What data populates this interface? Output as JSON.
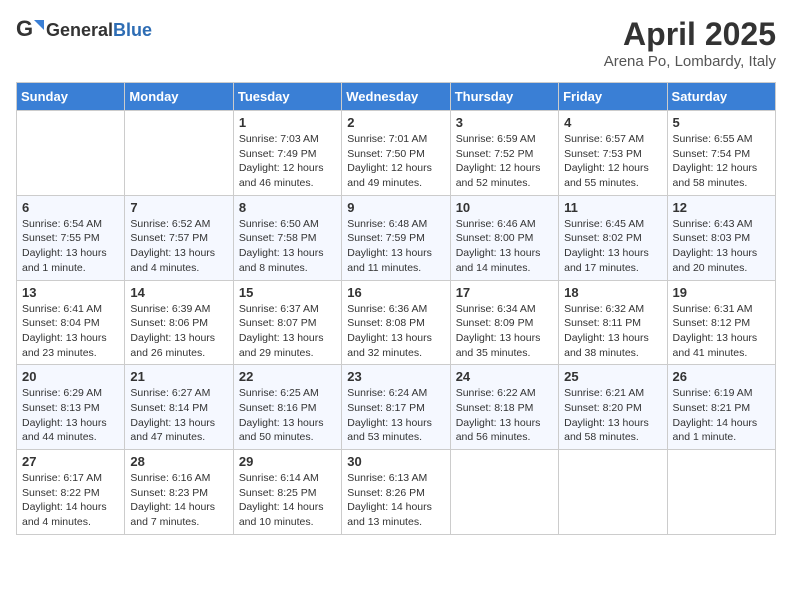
{
  "header": {
    "logo_general": "General",
    "logo_blue": "Blue",
    "month": "April 2025",
    "location": "Arena Po, Lombardy, Italy"
  },
  "weekdays": [
    "Sunday",
    "Monday",
    "Tuesday",
    "Wednesday",
    "Thursday",
    "Friday",
    "Saturday"
  ],
  "weeks": [
    [
      null,
      null,
      {
        "day": "1",
        "sunrise": "Sunrise: 7:03 AM",
        "sunset": "Sunset: 7:49 PM",
        "daylight": "Daylight: 12 hours and 46 minutes."
      },
      {
        "day": "2",
        "sunrise": "Sunrise: 7:01 AM",
        "sunset": "Sunset: 7:50 PM",
        "daylight": "Daylight: 12 hours and 49 minutes."
      },
      {
        "day": "3",
        "sunrise": "Sunrise: 6:59 AM",
        "sunset": "Sunset: 7:52 PM",
        "daylight": "Daylight: 12 hours and 52 minutes."
      },
      {
        "day": "4",
        "sunrise": "Sunrise: 6:57 AM",
        "sunset": "Sunset: 7:53 PM",
        "daylight": "Daylight: 12 hours and 55 minutes."
      },
      {
        "day": "5",
        "sunrise": "Sunrise: 6:55 AM",
        "sunset": "Sunset: 7:54 PM",
        "daylight": "Daylight: 12 hours and 58 minutes."
      }
    ],
    [
      {
        "day": "6",
        "sunrise": "Sunrise: 6:54 AM",
        "sunset": "Sunset: 7:55 PM",
        "daylight": "Daylight: 13 hours and 1 minute."
      },
      {
        "day": "7",
        "sunrise": "Sunrise: 6:52 AM",
        "sunset": "Sunset: 7:57 PM",
        "daylight": "Daylight: 13 hours and 4 minutes."
      },
      {
        "day": "8",
        "sunrise": "Sunrise: 6:50 AM",
        "sunset": "Sunset: 7:58 PM",
        "daylight": "Daylight: 13 hours and 8 minutes."
      },
      {
        "day": "9",
        "sunrise": "Sunrise: 6:48 AM",
        "sunset": "Sunset: 7:59 PM",
        "daylight": "Daylight: 13 hours and 11 minutes."
      },
      {
        "day": "10",
        "sunrise": "Sunrise: 6:46 AM",
        "sunset": "Sunset: 8:00 PM",
        "daylight": "Daylight: 13 hours and 14 minutes."
      },
      {
        "day": "11",
        "sunrise": "Sunrise: 6:45 AM",
        "sunset": "Sunset: 8:02 PM",
        "daylight": "Daylight: 13 hours and 17 minutes."
      },
      {
        "day": "12",
        "sunrise": "Sunrise: 6:43 AM",
        "sunset": "Sunset: 8:03 PM",
        "daylight": "Daylight: 13 hours and 20 minutes."
      }
    ],
    [
      {
        "day": "13",
        "sunrise": "Sunrise: 6:41 AM",
        "sunset": "Sunset: 8:04 PM",
        "daylight": "Daylight: 13 hours and 23 minutes."
      },
      {
        "day": "14",
        "sunrise": "Sunrise: 6:39 AM",
        "sunset": "Sunset: 8:06 PM",
        "daylight": "Daylight: 13 hours and 26 minutes."
      },
      {
        "day": "15",
        "sunrise": "Sunrise: 6:37 AM",
        "sunset": "Sunset: 8:07 PM",
        "daylight": "Daylight: 13 hours and 29 minutes."
      },
      {
        "day": "16",
        "sunrise": "Sunrise: 6:36 AM",
        "sunset": "Sunset: 8:08 PM",
        "daylight": "Daylight: 13 hours and 32 minutes."
      },
      {
        "day": "17",
        "sunrise": "Sunrise: 6:34 AM",
        "sunset": "Sunset: 8:09 PM",
        "daylight": "Daylight: 13 hours and 35 minutes."
      },
      {
        "day": "18",
        "sunrise": "Sunrise: 6:32 AM",
        "sunset": "Sunset: 8:11 PM",
        "daylight": "Daylight: 13 hours and 38 minutes."
      },
      {
        "day": "19",
        "sunrise": "Sunrise: 6:31 AM",
        "sunset": "Sunset: 8:12 PM",
        "daylight": "Daylight: 13 hours and 41 minutes."
      }
    ],
    [
      {
        "day": "20",
        "sunrise": "Sunrise: 6:29 AM",
        "sunset": "Sunset: 8:13 PM",
        "daylight": "Daylight: 13 hours and 44 minutes."
      },
      {
        "day": "21",
        "sunrise": "Sunrise: 6:27 AM",
        "sunset": "Sunset: 8:14 PM",
        "daylight": "Daylight: 13 hours and 47 minutes."
      },
      {
        "day": "22",
        "sunrise": "Sunrise: 6:25 AM",
        "sunset": "Sunset: 8:16 PM",
        "daylight": "Daylight: 13 hours and 50 minutes."
      },
      {
        "day": "23",
        "sunrise": "Sunrise: 6:24 AM",
        "sunset": "Sunset: 8:17 PM",
        "daylight": "Daylight: 13 hours and 53 minutes."
      },
      {
        "day": "24",
        "sunrise": "Sunrise: 6:22 AM",
        "sunset": "Sunset: 8:18 PM",
        "daylight": "Daylight: 13 hours and 56 minutes."
      },
      {
        "day": "25",
        "sunrise": "Sunrise: 6:21 AM",
        "sunset": "Sunset: 8:20 PM",
        "daylight": "Daylight: 13 hours and 58 minutes."
      },
      {
        "day": "26",
        "sunrise": "Sunrise: 6:19 AM",
        "sunset": "Sunset: 8:21 PM",
        "daylight": "Daylight: 14 hours and 1 minute."
      }
    ],
    [
      {
        "day": "27",
        "sunrise": "Sunrise: 6:17 AM",
        "sunset": "Sunset: 8:22 PM",
        "daylight": "Daylight: 14 hours and 4 minutes."
      },
      {
        "day": "28",
        "sunrise": "Sunrise: 6:16 AM",
        "sunset": "Sunset: 8:23 PM",
        "daylight": "Daylight: 14 hours and 7 minutes."
      },
      {
        "day": "29",
        "sunrise": "Sunrise: 6:14 AM",
        "sunset": "Sunset: 8:25 PM",
        "daylight": "Daylight: 14 hours and 10 minutes."
      },
      {
        "day": "30",
        "sunrise": "Sunrise: 6:13 AM",
        "sunset": "Sunset: 8:26 PM",
        "daylight": "Daylight: 14 hours and 13 minutes."
      },
      null,
      null,
      null
    ]
  ]
}
